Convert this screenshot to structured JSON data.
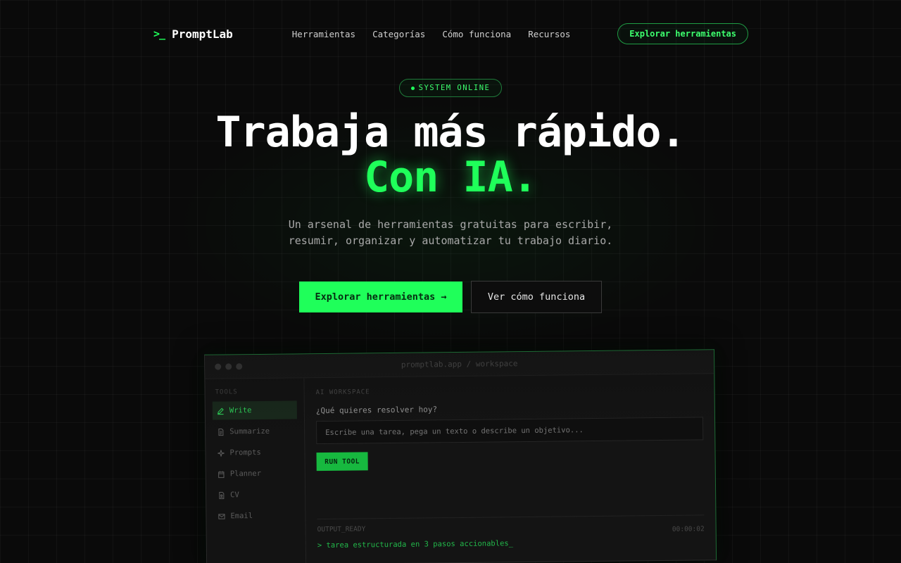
{
  "nav": {
    "logo_icon": ">_",
    "logo_text": "PromptLab",
    "links": [
      "Herramientas",
      "Categorías",
      "Cómo funciona",
      "Recursos"
    ],
    "cta": "Explorar herramientas"
  },
  "badge": "SYSTEM ONLINE",
  "hero": {
    "title_line1": "Trabaja más rápido.",
    "title_line2": "Con IA.",
    "subtitle_line1": "Un arsenal de herramientas gratuitas para escribir,",
    "subtitle_line2": "resumir, organizar y automatizar tu trabajo diario.",
    "primary_button": "Explorar herramientas →",
    "secondary_button": "Ver cómo funciona"
  },
  "workspace": {
    "url": "promptlab.app / workspace",
    "sidebar_heading": "TOOLS",
    "sidebar_items": [
      "Write",
      "Summarize",
      "Prompts",
      "Planner",
      "CV",
      "Email"
    ],
    "active_item": "Write",
    "main_heading": "AI WORKSPACE",
    "question": "¿Qué quieres resolver hoy?",
    "input_placeholder": "Escribe una tarea, pega un texto o describe un objetivo...",
    "run_button": "RUN TOOL",
    "output_label": "OUTPUT_READY",
    "output_time": "00:00:02",
    "output_text": "> tarea estructurada en 3 pasos accionables_"
  },
  "colors": {
    "accent": "#1fff5a",
    "background": "#0a0a0a"
  }
}
